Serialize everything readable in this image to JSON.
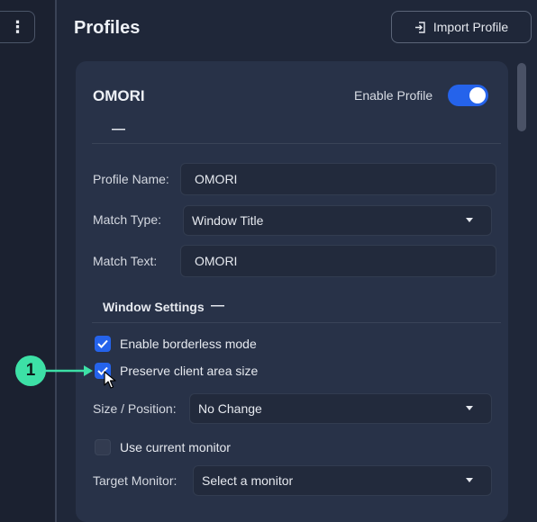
{
  "page": {
    "title": "Profiles"
  },
  "toolbar": {
    "import_label": "Import Profile",
    "menu_icon": "kebab-menu-icon",
    "import_icon": "import-icon"
  },
  "profile": {
    "name_heading": "OMORI",
    "enable_label": "Enable Profile",
    "enabled": true,
    "collapse_glyph": "—",
    "fields": {
      "name_label": "Profile Name:",
      "name_value": "OMORI",
      "match_type_label": "Match Type:",
      "match_type_value": "Window Title",
      "match_text_label": "Match Text:",
      "match_text_value": "OMORI"
    }
  },
  "window_settings": {
    "title": "Window Settings",
    "collapse_glyph": "—",
    "borderless_label": "Enable borderless mode",
    "borderless_checked": true,
    "preserve_label": "Preserve client area size",
    "preserve_checked": true,
    "size_position_label": "Size / Position:",
    "size_position_value": "No Change",
    "use_current_monitor_label": "Use current monitor",
    "use_current_monitor_checked": false,
    "target_monitor_label": "Target Monitor:",
    "target_monitor_value": "Select a monitor"
  },
  "annotation": {
    "step_number": "1"
  },
  "colors": {
    "accent": "#2563eb",
    "callout": "#3de0a6",
    "card": "#283248",
    "background": "#1f2739"
  }
}
